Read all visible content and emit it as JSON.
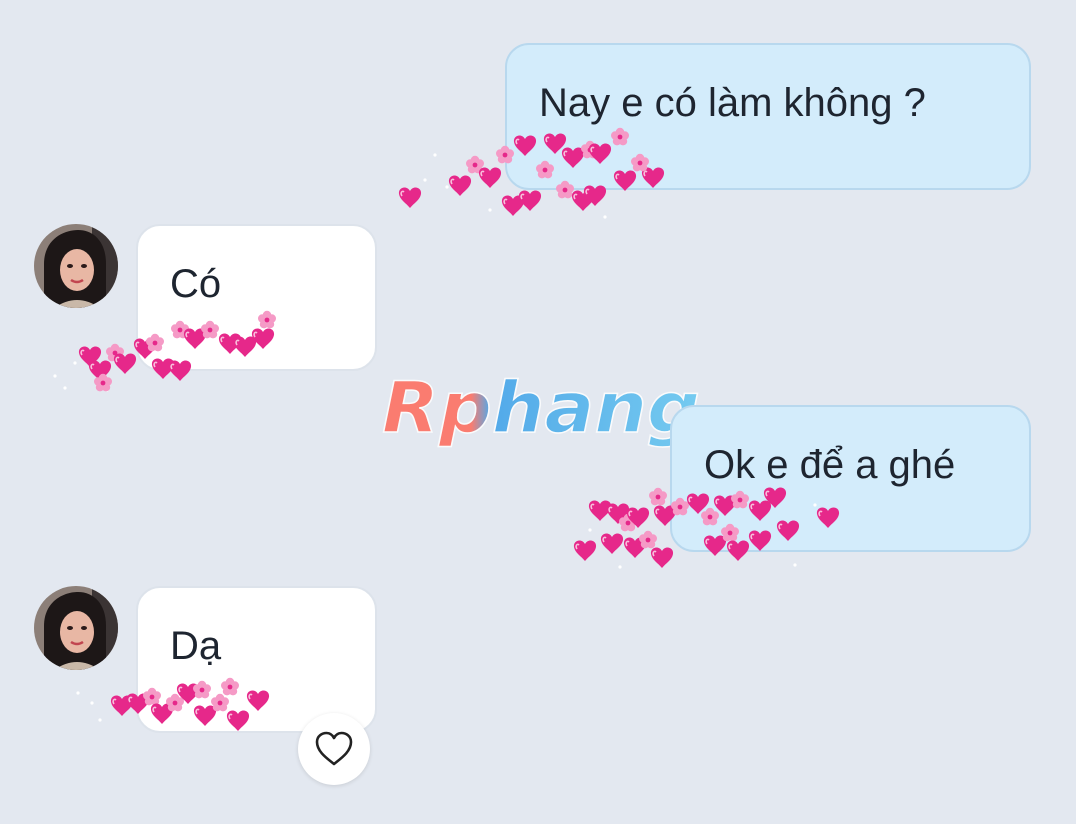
{
  "messages": [
    {
      "side": "out",
      "text": "Nay e có làm không ?"
    },
    {
      "side": "in",
      "text": "Có"
    },
    {
      "side": "out",
      "text": "Ok e để a ghé"
    },
    {
      "side": "in",
      "text": "Dạ"
    }
  ],
  "watermark": {
    "text": "Rphang"
  },
  "reaction": {
    "icon": "heart-outline-icon"
  },
  "colors": {
    "background": "#e3e8f0",
    "outgoing_bubble": "#d3ecfb",
    "incoming_bubble": "#ffffff",
    "sticker_pink": "#e6288a"
  }
}
